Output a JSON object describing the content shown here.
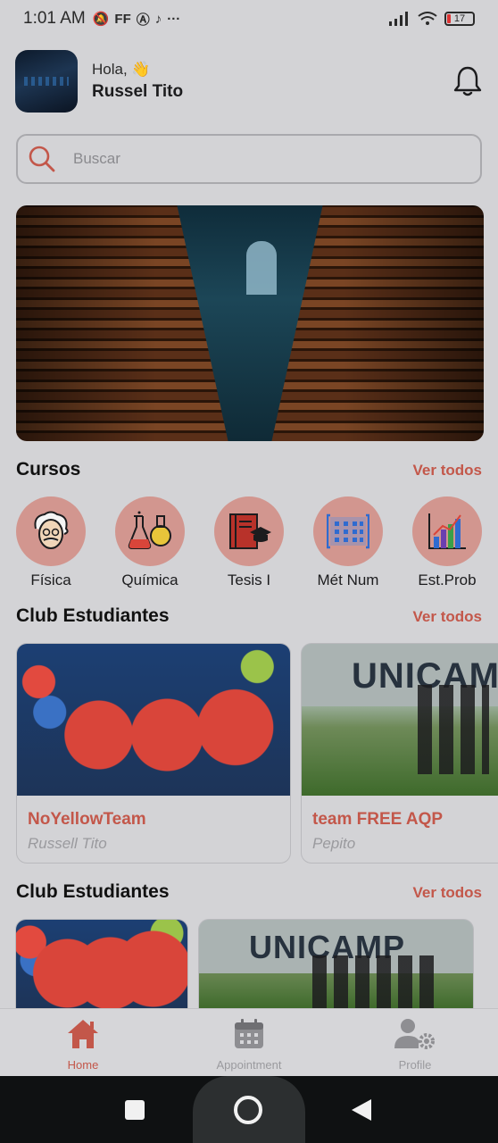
{
  "status_bar": {
    "time": "1:01 AM",
    "icons": [
      "muted-icon",
      "ff-icon",
      "a-icon",
      "tiktok-icon",
      "more-icon"
    ],
    "battery": "17"
  },
  "header": {
    "greeting": "Hola, 👋",
    "user_name": "Russel Tito"
  },
  "search": {
    "placeholder": "Buscar"
  },
  "courses_section": {
    "title": "Cursos",
    "see_all": "Ver todos",
    "items": [
      {
        "label": "Física",
        "icon": "einstein-icon"
      },
      {
        "label": "Química",
        "icon": "flask-icon"
      },
      {
        "label": "Tesis I",
        "icon": "book-icon"
      },
      {
        "label": "Mét Num",
        "icon": "grid-icon"
      },
      {
        "label": "Est.Prob",
        "icon": "bar-chart-icon"
      }
    ]
  },
  "club_section_1": {
    "title": "Club Estudiantes",
    "see_all": "Ver todos",
    "cards": [
      {
        "title": "NoYellowTeam",
        "author": "Russell Tito"
      },
      {
        "title": "team FREE AQP",
        "author": "Pepito"
      }
    ]
  },
  "club_section_2": {
    "title": "Club Estudiantes",
    "see_all": "Ver todos"
  },
  "unicamp_sign": "UNICAMP",
  "bottom_nav": {
    "items": [
      {
        "label": "Home",
        "icon": "home-icon",
        "active": true
      },
      {
        "label": "Appointment",
        "icon": "calendar-icon",
        "active": false
      },
      {
        "label": "Profile",
        "icon": "profile-settings-icon",
        "active": false
      }
    ]
  },
  "colors": {
    "accent": "#c3574a",
    "course_circle": "#d2968f",
    "background": "#d3d3d6"
  }
}
